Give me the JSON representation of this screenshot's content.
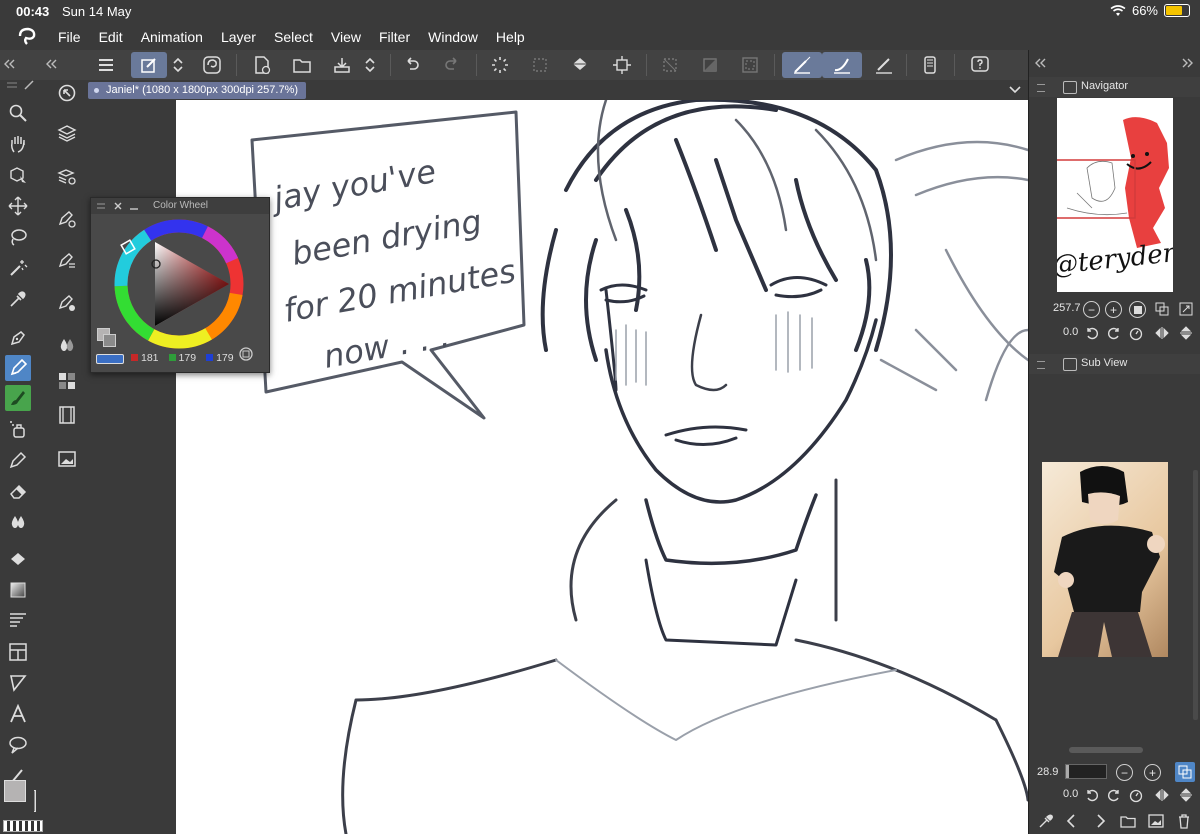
{
  "status": {
    "time": "00:43",
    "date": "Sun 14 May",
    "battery": "66%",
    "battery_level": 0.66
  },
  "menu": [
    "File",
    "Edit",
    "Animation",
    "Layer",
    "Select",
    "View",
    "Filter",
    "Window",
    "Help"
  ],
  "document_tab": {
    "title": "Janiel* (1080 x 1800px 300dpi 257.7%)"
  },
  "color_wheel": {
    "title": "Color Wheel",
    "r": "181",
    "g": "179",
    "b": "179",
    "colors": {
      "r_swatch": "#c62828",
      "g_swatch": "#2e9d3a",
      "b_swatch": "#1e3fd6"
    }
  },
  "navigator": {
    "title": "Navigator",
    "zoom": "257.7",
    "rotation": "0.0"
  },
  "sub_view": {
    "title": "Sub View",
    "zoom": "28.9",
    "rotation": "0.0"
  },
  "canvas": {
    "speech_bubble_lines": [
      "jay you've",
      "been drying",
      "for 20 minutes",
      "now . . ."
    ],
    "signature": "@teryden"
  },
  "colors": {
    "accent": "#4f86c6",
    "active_cmd": "#6a7a9a",
    "tab": "#6a7499",
    "navigator_box": "#d33b3b",
    "paint_red": "#e8403f"
  }
}
